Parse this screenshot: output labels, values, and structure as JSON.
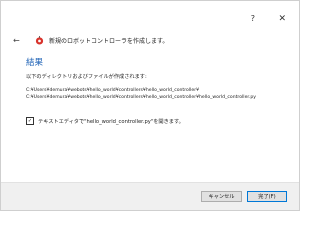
{
  "window": {
    "help_label": "?",
    "close_label": "✕"
  },
  "header": {
    "back_label": "←",
    "title": "新規のロボットコントローラを作成します。",
    "icon": "robot-icon"
  },
  "main": {
    "section_title": "結果",
    "message": "以下のディレクトリおよびファイルが作成されます:",
    "paths": [
      "C:¥Users¥demura¥webots¥hello_world¥controllers¥hello_world_controller¥",
      "C:¥Users¥demura¥webots¥hello_world¥controllers¥hello_world_controller¥hello_world_controller.py"
    ],
    "checkbox_label": "テキストエディタで\"hello_world_controller.py\"を開きます。",
    "checkbox_checked": true
  },
  "footer": {
    "cancel_label": "キャンセル",
    "finish_label": "完了(F)"
  },
  "colors": {
    "accent": "#1a5fb4",
    "focus_border": "#0078d7"
  }
}
